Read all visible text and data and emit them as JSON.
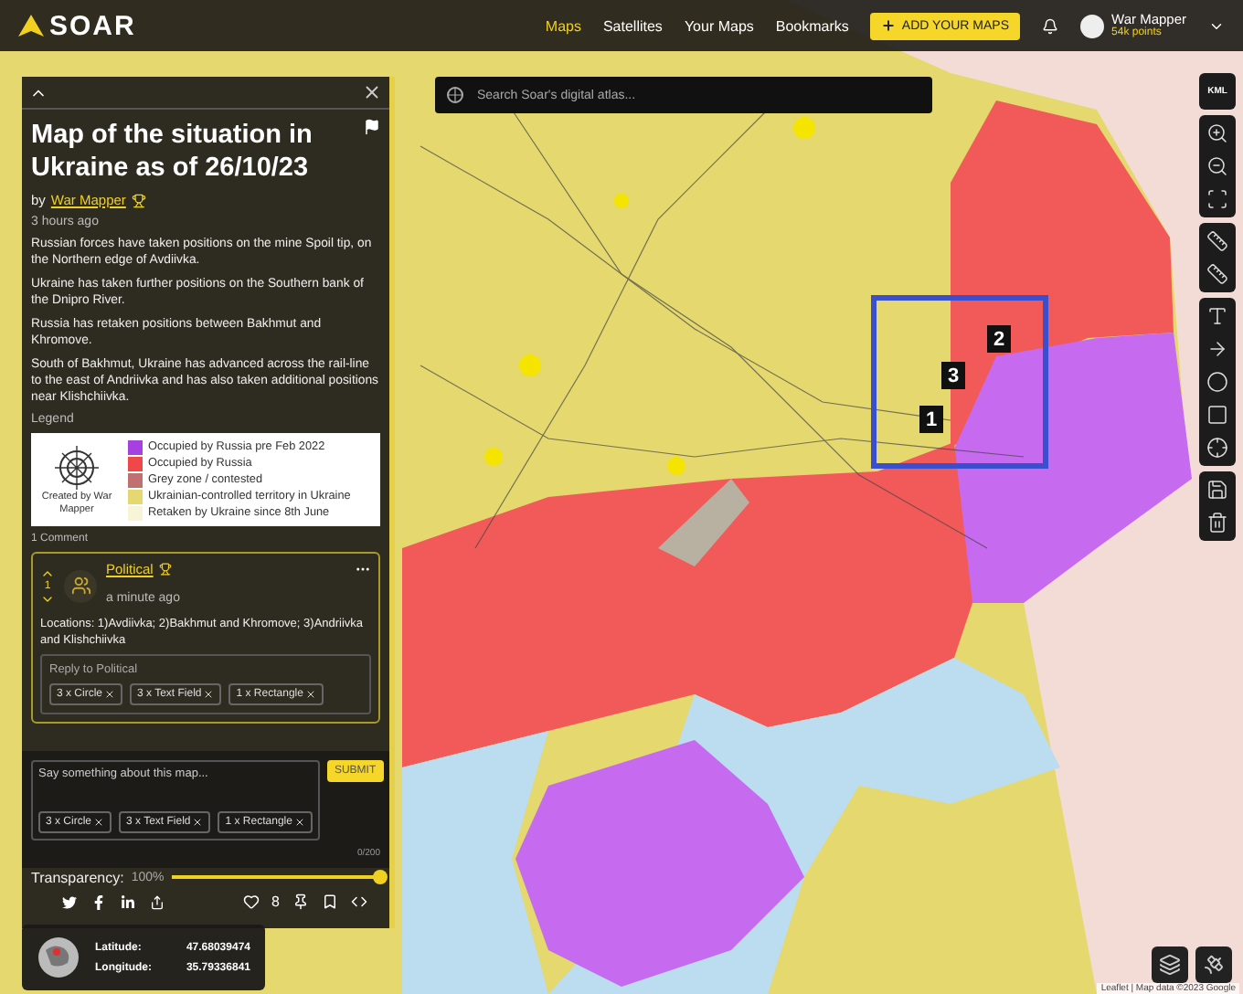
{
  "nav": {
    "logo": "SOAR",
    "links": [
      {
        "label": "Maps",
        "selected": true
      },
      {
        "label": "Satellites",
        "selected": false
      },
      {
        "label": "Your Maps",
        "selected": false
      },
      {
        "label": "Bookmarks",
        "selected": false
      }
    ],
    "add_button": "ADD YOUR MAPS",
    "user": {
      "name": "War Mapper",
      "points": "54k points"
    }
  },
  "search": {
    "placeholder": "Search Soar's digital atlas..."
  },
  "post": {
    "title": "Map of the situation in Ukraine as of 26/10/23",
    "byline": "by",
    "author": "War Mapper",
    "time": "3 hours ago",
    "paragraphs": [
      "Russian forces have taken positions on the mine Spoil tip, on the Northern edge of Avdiivka.",
      "Ukraine has taken further positions on the Southern bank of the Dnipro River.",
      "Russia has retaken positions between Bakhmut and Khromove.",
      "South of Bakhmut, Ukraine has advanced across the rail-line to the east of Andriivka and has also taken additional positions near Klishchiivka."
    ],
    "legend_title": "Legend",
    "legend": {
      "caption": "Created by War Mapper",
      "items": [
        {
          "label": "Occupied by Russia pre Feb 2022",
          "color": "#a640e0"
        },
        {
          "label": "Occupied by Russia",
          "color": "#f04848"
        },
        {
          "label": "Grey zone / contested",
          "color": "#c07070"
        },
        {
          "label": "Ukrainian-controlled territory in Ukraine",
          "color": "#e6d870"
        },
        {
          "label": "Retaken by Ukraine since 8th June",
          "color": "#f8f4d8"
        }
      ]
    }
  },
  "comments": {
    "count": "1 Comment",
    "items": [
      {
        "author": "Political",
        "votes": "1",
        "time": "a minute ago",
        "text": "Locations: 1)Avdiivka; 2)Bakhmut and Khromove; 3)Andriivka and Klishchiivka",
        "reply": {
          "placeholder": "Reply to Political",
          "tags": [
            "3 x Circle",
            "3 x Text Field",
            "1 x Rectangle"
          ]
        }
      }
    ]
  },
  "composer": {
    "placeholder": "Say something about this map...",
    "submit": "SUBMIT",
    "tags": [
      "3 x Circle",
      "3 x Text Field",
      "1 x Rectangle"
    ],
    "counter": "0/200"
  },
  "transparency": {
    "label": "Transparency:",
    "reading": "100%",
    "level": 1
  },
  "likes": "8",
  "coordinates": {
    "latitude_label": "Latitude:",
    "latitude": "47.68039474",
    "longitude_label": "Longitude:",
    "longitude": "35.79336841"
  },
  "markers": [
    {
      "label": "1"
    },
    {
      "label": "2"
    },
    {
      "label": "3"
    }
  ],
  "tools": {
    "kml": "KML"
  },
  "attribution": "Leaflet | Map data ©2023 Google"
}
